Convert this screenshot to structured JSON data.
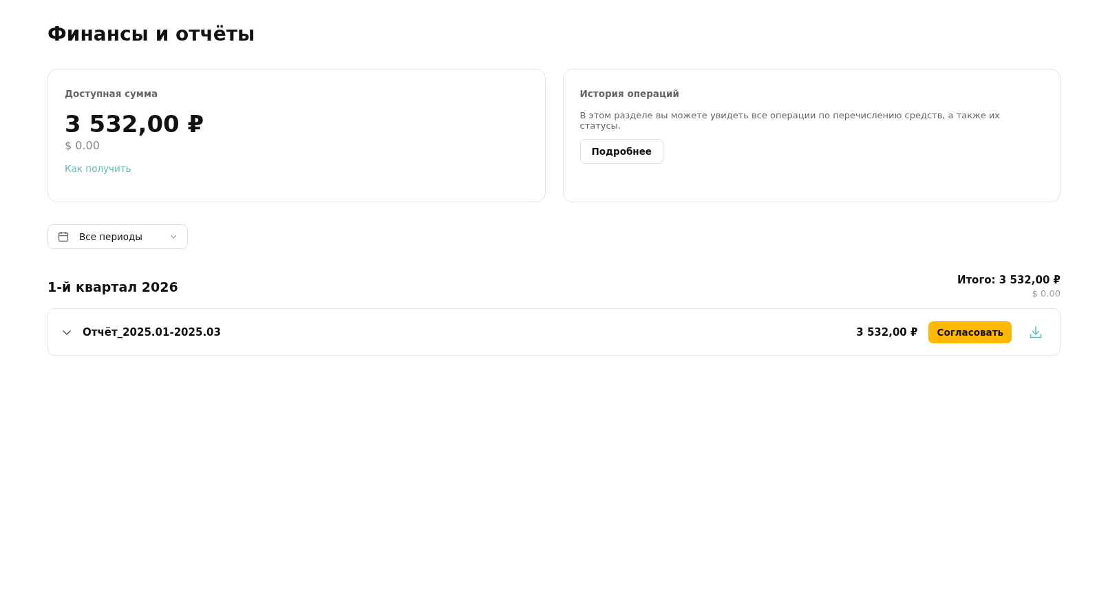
{
  "page": {
    "title": "Финансы и отчёты"
  },
  "balance_card": {
    "label": "Доступная сумма",
    "amount": "3 532,00 ₽",
    "amount_usd": "$ 0.00",
    "link": "Как получить"
  },
  "history_card": {
    "label": "История операций",
    "description": "В этом разделе вы можете увидеть все операции по перечислению средств, а также их статусы.",
    "button": "Подробнее"
  },
  "period_filter": {
    "value": "Все периоды"
  },
  "quarters": [
    {
      "title": "1-й квартал 2026",
      "total": "Итого: 3 532,00 ₽",
      "total_usd": "$ 0.00",
      "reports": [
        {
          "name": "Отчёт_2025.01-2025.03",
          "expanded": false,
          "amount": "3 532,00 ₽",
          "action": "Согласовать"
        }
      ]
    }
  ]
}
